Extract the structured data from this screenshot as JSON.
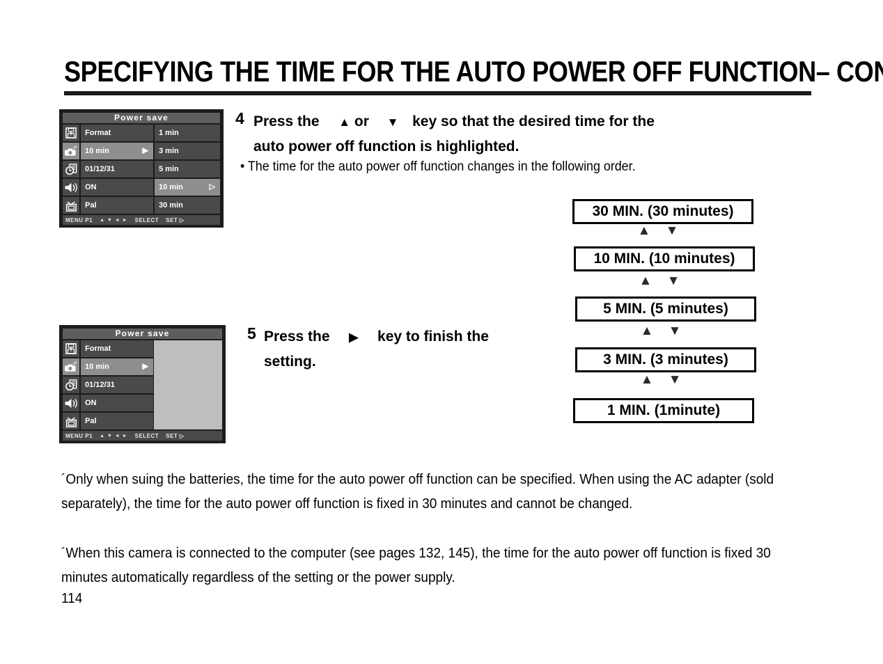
{
  "document": {
    "title": "SPECIFYING THE TIME FOR THE AUTO POWER OFF FUNCTION– CONT'D",
    "page_number": "114"
  },
  "lcd_screen_1": {
    "title": "Power save",
    "rows": [
      {
        "icon": "format-disk-icon",
        "left": "Format",
        "left_arrow": "",
        "right": "1 min",
        "right_arrow": "",
        "left_hl": false,
        "right_hl": false
      },
      {
        "icon": "camera-sleep-icon",
        "left": "10 min",
        "left_arrow": "▶",
        "right": "3 min",
        "right_arrow": "",
        "left_hl": true,
        "right_hl": false
      },
      {
        "icon": "clock-card-icon",
        "left": "01/12/31",
        "left_arrow": "",
        "right": "5 min",
        "right_arrow": "",
        "left_hl": false,
        "right_hl": false
      },
      {
        "icon": "speaker-icon",
        "left": "ON",
        "left_arrow": "",
        "right": "10 min",
        "right_arrow": "▷",
        "left_hl": false,
        "right_hl": true
      },
      {
        "icon": "tv-icon",
        "left": "Pal",
        "left_arrow": "",
        "right": "30 min",
        "right_arrow": "",
        "left_hl": false,
        "right_hl": false
      }
    ],
    "status": {
      "menu": "MENU P1",
      "arrows": "▲ ▼ ◄ ►",
      "select": "SELECT",
      "set": "SET ▷"
    }
  },
  "lcd_screen_2": {
    "title": "Power save",
    "rows": [
      {
        "icon": "format-disk-icon",
        "left": "Format",
        "left_arrow": "",
        "left_hl": false
      },
      {
        "icon": "camera-sleep-icon",
        "left": "10 min",
        "left_arrow": "▶",
        "left_hl": true
      },
      {
        "icon": "clock-card-icon",
        "left": "01/12/31",
        "left_arrow": "",
        "left_hl": false
      },
      {
        "icon": "speaker-icon",
        "left": "ON",
        "left_arrow": "",
        "left_hl": false
      },
      {
        "icon": "tv-icon",
        "left": "Pal",
        "left_arrow": "",
        "left_hl": false
      }
    ],
    "status": {
      "menu": "MENU P1",
      "arrows": "▲ ▼ ◄ ►",
      "select": "SELECT",
      "set": "SET ▷"
    }
  },
  "step4": {
    "number": "4",
    "line1_a": "Press the",
    "up_arrow": "▲",
    "line1_b": "or",
    "down_arrow": "▼",
    "line1_c": "key so that the desired time for the",
    "line2": "auto power off function is highlighted.",
    "bullet": "• The time for the auto power off function changes in the following order."
  },
  "step5": {
    "number": "5",
    "line1_a": "Press the",
    "right_arrow": "▶",
    "line1_b": "key to finish the",
    "line2": "setting."
  },
  "flow": {
    "items": [
      {
        "label": "30 MIN. (30 minutes)"
      },
      {
        "label": "10 MIN. (10 minutes)"
      },
      {
        "label": "5 MIN. (5 minutes)"
      },
      {
        "label": "3 MIN. (3 minutes)"
      },
      {
        "label": "1 MIN. (1minute)"
      }
    ],
    "connector": "▲ ▼"
  },
  "notes": {
    "note1": "´Only when suing the batteries, the time for the auto power off function can be specified. When using the AC adapter (sold separately), the time for the auto power off function is fixed in 30 minutes and cannot be changed.",
    "note2": "´When this camera is connected to the computer (see pages 132, 145), the time for the auto power off function is fixed 30 minutes automatically regardless of the setting or the power supply."
  },
  "colors": {
    "lcd_bezel": "#1c1c1c",
    "lcd_cell": "#4a4a4a",
    "lcd_highlight": "#8e8e8e",
    "lcd_title_bar": "#5e5e5e",
    "lcd_blank_panel": "#bebebe",
    "rule": "#1a1a1a"
  }
}
